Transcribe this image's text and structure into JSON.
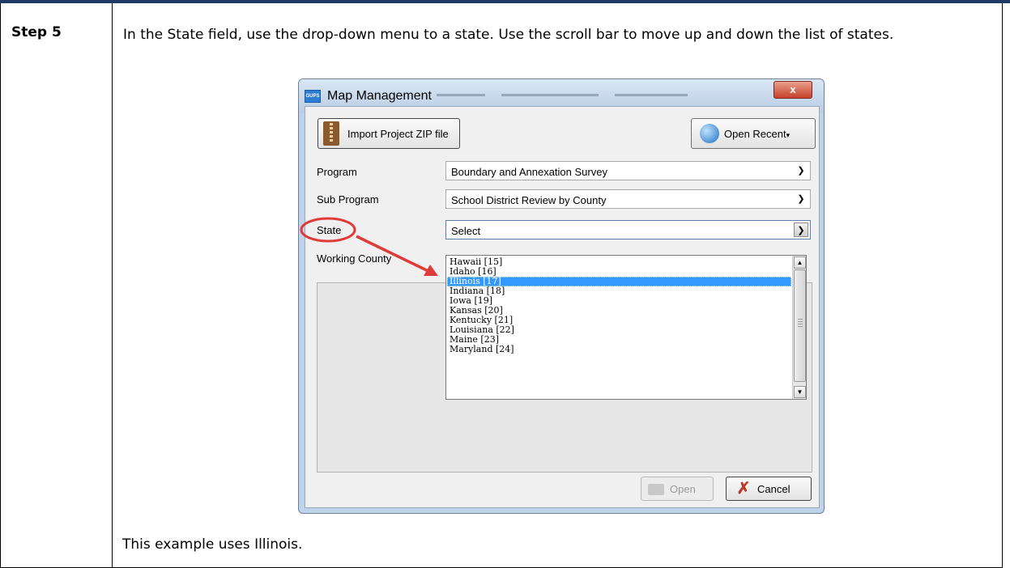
{
  "step": {
    "label": "Step 5"
  },
  "instructions": "In the State field, use the drop-down menu to a state. Use the scroll bar to move up and down the list of states.",
  "footer": "This example uses Illinois.",
  "dialog": {
    "title": "Map Management",
    "app_icon_text": "GUPS",
    "close_label": "x",
    "import_button": "Import Project ZIP file",
    "open_recent_button": "Open Recent",
    "program": {
      "label": "Program",
      "value": "Boundary and Annexation Survey"
    },
    "sub_program": {
      "label": "Sub Program",
      "value": "School District Review by County"
    },
    "state": {
      "label": "State",
      "value": "Select"
    },
    "working_county": {
      "label": "Working County"
    },
    "state_options": [
      "Hawaii [15]",
      "Idaho [16]",
      "Illinois [17]",
      "Indiana [18]",
      "Iowa [19]",
      "Kansas [20]",
      "Kentucky [21]",
      "Louisiana [22]",
      "Maine [23]",
      "Maryland [24]"
    ],
    "selected_option": "Illinois [17]",
    "open_button": "Open",
    "cancel_button": "Cancel"
  },
  "annotation_color": "#e03a3a"
}
